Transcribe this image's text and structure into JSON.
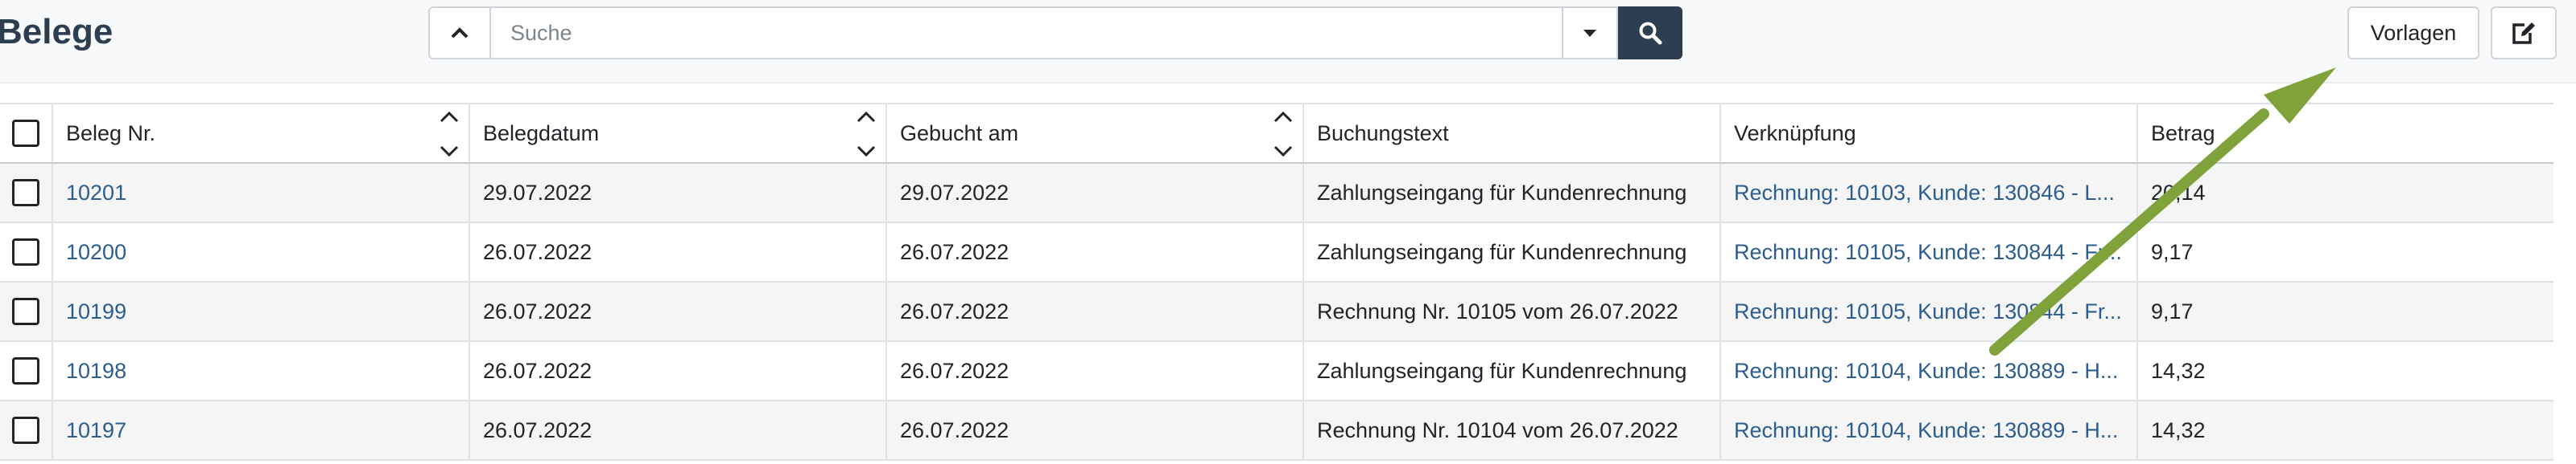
{
  "header": {
    "title": "Belege",
    "search_placeholder": "Suche",
    "vorlagen_label": "Vorlagen"
  },
  "table": {
    "columns": [
      "Beleg Nr.",
      "Belegdatum",
      "Gebucht am",
      "Buchungstext",
      "Verknüpfung",
      "Betrag"
    ],
    "rows": [
      [
        "10201",
        "29.07.2022",
        "29.07.2022",
        "Zahlungseingang für Kundenrechnung",
        "Rechnung: 10103, Kunde: 130846 - L...",
        "20,14"
      ],
      [
        "10200",
        "26.07.2022",
        "26.07.2022",
        "Zahlungseingang für Kundenrechnung",
        "Rechnung: 10105, Kunde: 130844 - Fr...",
        "9,17"
      ],
      [
        "10199",
        "26.07.2022",
        "26.07.2022",
        "Rechnung Nr. 10105 vom 26.07.2022",
        "Rechnung: 10105, Kunde: 130844 - Fr...",
        "9,17"
      ],
      [
        "10198",
        "26.07.2022",
        "26.07.2022",
        "Zahlungseingang für Kundenrechnung",
        "Rechnung: 10104, Kunde: 130889 - H...",
        "14,32"
      ],
      [
        "10197",
        "26.07.2022",
        "26.07.2022",
        "Rechnung Nr. 10104 vom 26.07.2022",
        "Rechnung: 10104, Kunde: 130889 - H...",
        "14,32"
      ]
    ]
  },
  "icons": {
    "collapse": "chevron-up-icon",
    "dropdown": "caret-down-icon",
    "search": "search-icon",
    "edit": "edit-icon",
    "sort": "sort-icon"
  },
  "colors": {
    "title": "#2c3e50",
    "search_button": "#2c3e50",
    "link": "#2c5d8f",
    "annotation_arrow": "#7fa33a"
  }
}
